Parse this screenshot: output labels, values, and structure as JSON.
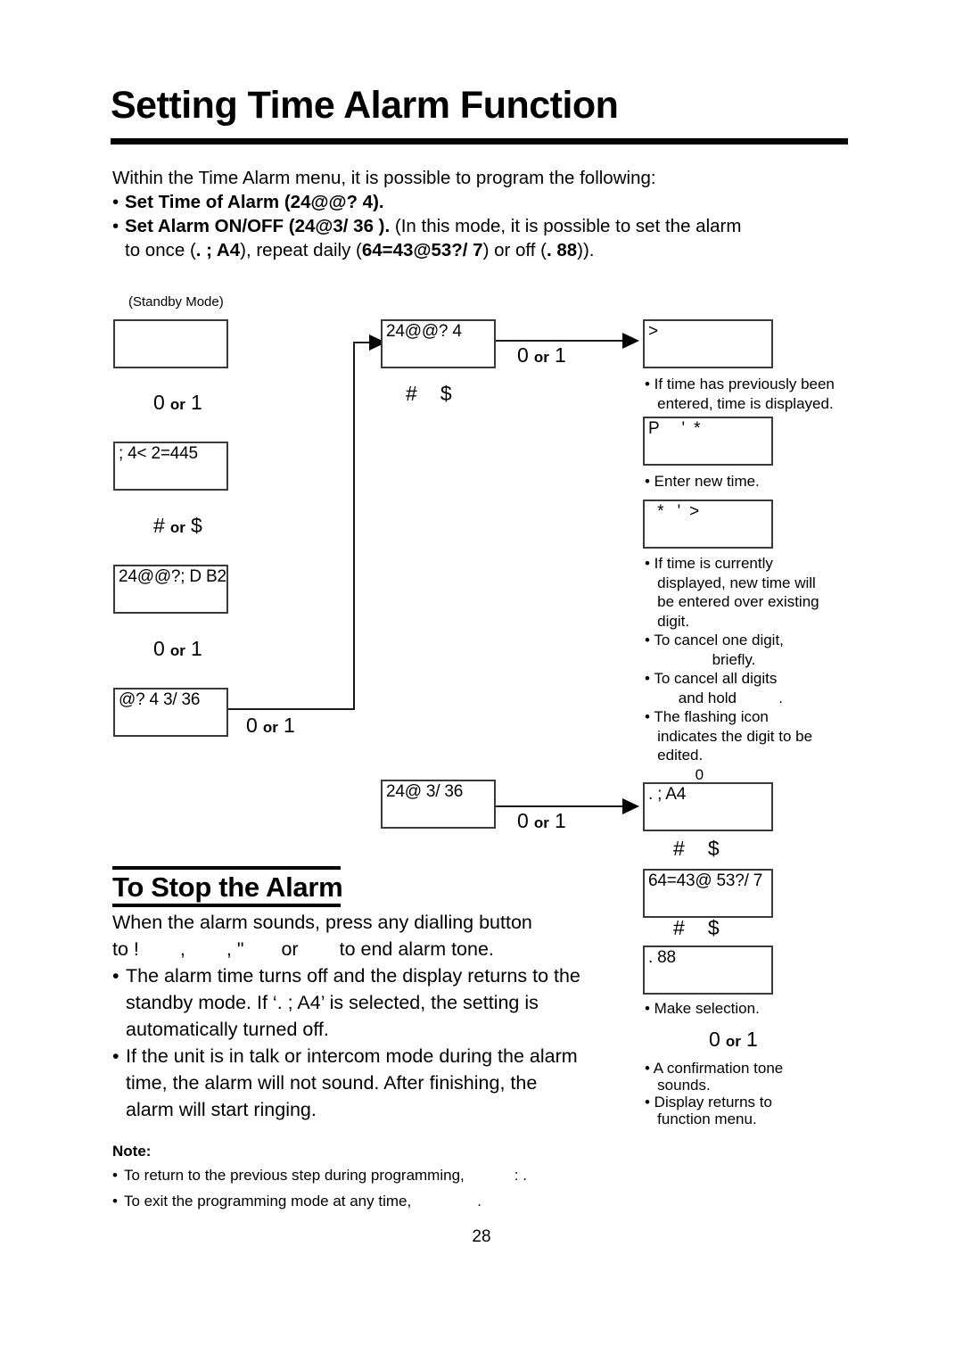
{
  "page": {
    "title": "Setting Time Alarm Function",
    "number": "28"
  },
  "intro": {
    "lead": "Within the Time Alarm menu, it is possible to program the following:",
    "bullets": [
      {
        "bold_prefix": "Set Time of Alarm (24@@?  4).",
        "rest": ""
      },
      {
        "bold_prefix": "Set Alarm ON/OFF (24@3/ 36  ).",
        "rest": " (In this mode, it is possible to set the alarm",
        "line2_pre": "to once (",
        "line2_bold1": ". ; A4",
        "line2_mid": "), repeat daily (",
        "line2_bold2": "64=43@53?/ 7",
        "line2_mid2": ") or off (",
        "line2_bold3": ". 88",
        "line2_end": "))."
      }
    ]
  },
  "diagram": {
    "standby_caption": "(Standby Mode)",
    "left_column": {
      "box1_text": "",
      "hint1": {
        "left": "0",
        "or": "or",
        "right": "1"
      },
      "box2_text": "; 4< 2=445",
      "hint2": {
        "left": "#",
        "or": "or",
        "right": "$"
      },
      "box3_text": "24@@?; D B2",
      "hint3": {
        "left": "0",
        "or": "or",
        "right": "1"
      },
      "box4_text": "@?  4 3/ 36",
      "hint4": {
        "left": "0",
        "or": "or",
        "right": "1"
      }
    },
    "middle_column": {
      "box_top_text": "24@@?  4",
      "hint_top": {
        "left": "#",
        "or": "",
        "right": "$"
      },
      "arrow_top_hint": {
        "left": "0",
        "or": "or",
        "right": "1"
      },
      "box_bottom_text": "24@ 3/ 36",
      "arrow_bottom_hint": {
        "left": "0",
        "or": "or",
        "right": "1"
      }
    },
    "right_column": {
      "box1_text": ">",
      "note1": [
        "• If time has previously been",
        "   entered, time is displayed."
      ],
      "box2_text": "P     '  *",
      "note2": [
        "• Enter new time."
      ],
      "box3_text": "  *   '  >",
      "note3": [
        "• If time is currently",
        "   displayed, new time will",
        "   be entered over existing",
        "   digit.",
        "• To cancel one digit,",
        "                briefly.",
        "• To cancel all digits",
        "        and hold          .",
        "• The flashing icon",
        "   indicates the digit to be",
        "   edited.",
        "            0"
      ],
      "box4_text": ". ; A4",
      "hint_a": {
        "left": "#",
        "or": "",
        "right": "$"
      },
      "box5_text": "64=43@ 53?/ 7",
      "hint_b": {
        "left": "#",
        "or": "",
        "right": "$"
      },
      "box6_text": ". 88",
      "note4": [
        "• Make selection."
      ],
      "hint_c": {
        "left": "0",
        "or": "or",
        "right": "1"
      },
      "note5": [
        "• A confirmation tone",
        "   sounds.",
        "• Display returns to",
        "   function menu."
      ]
    }
  },
  "stop_alarm": {
    "heading": "To Stop the Alarm",
    "para_line1": "When the alarm sounds, press any dialling button",
    "para_line2_a": "to !",
    "para_line2_b": ",",
    "para_line2_c": ", \"",
    "para_line2_d": "or",
    "para_line2_e": "to end alarm tone.",
    "bullets": [
      [
        "The alarm time turns off and the display returns to the",
        "standby mode. If ‘. ; A4’ is selected, the setting is",
        "automatically turned off."
      ],
      [
        "If the unit is in talk or intercom mode during the alarm",
        "time, the alarm will not sound. After finishing, the",
        "alarm will start ringing."
      ]
    ]
  },
  "note": {
    "heading": "Note:",
    "items": [
      {
        "text": "To return to the previous step during programming,",
        "tail": ":   ."
      },
      {
        "text": "To exit the programming mode at any time,",
        "tail": "."
      }
    ]
  }
}
